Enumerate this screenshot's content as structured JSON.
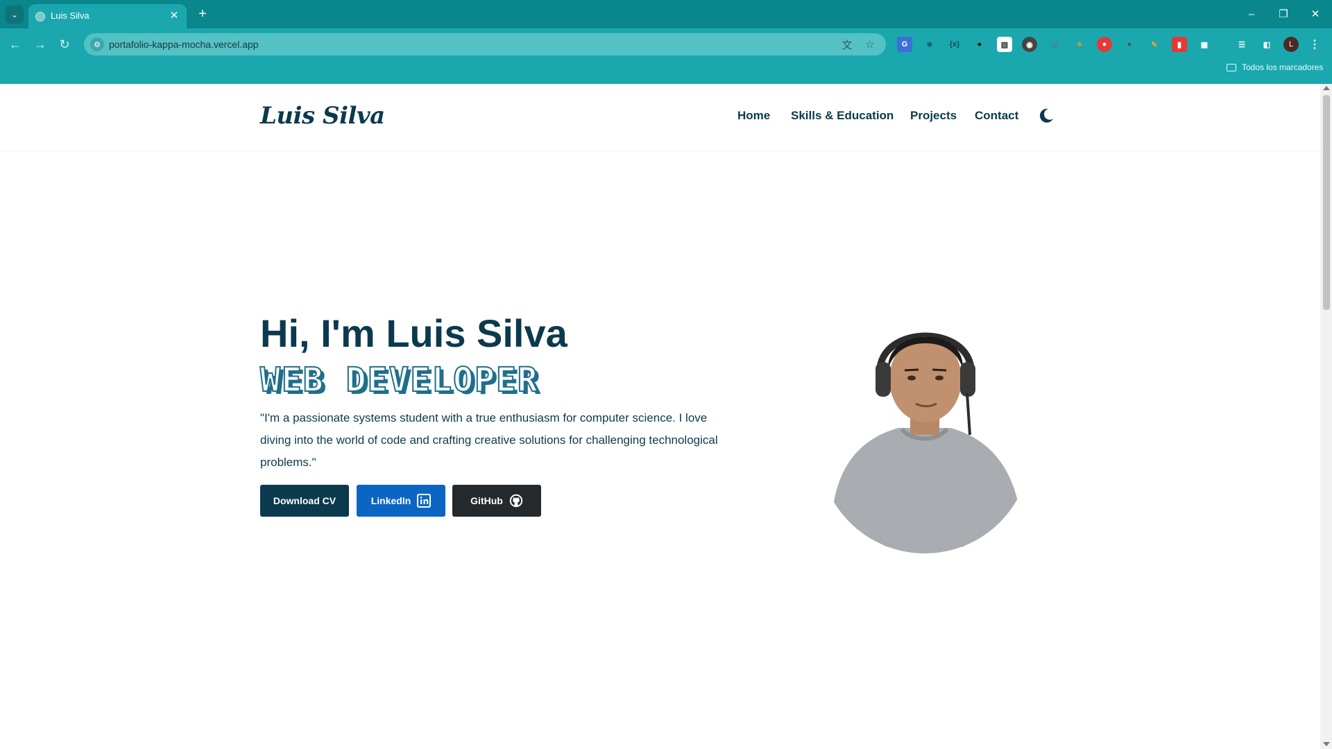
{
  "browser": {
    "tab_title": "Luis Silva",
    "url": "portafolio-kappa-mocha.vercel.app",
    "bookmarks_label": "Todos los marcadores",
    "profile_initial": "L"
  },
  "site": {
    "logo": "Luis Silva",
    "nav": [
      "Home",
      "Skills & Education",
      "Projects",
      "Contact"
    ]
  },
  "hero": {
    "title": "Hi, I'm Luis Silva",
    "subtitle": "WEB DEVELOPER",
    "description": "\"I'm a passionate systems student with a true enthusiasm for computer science. I love diving into the world of code and crafting creative solutions for challenging technological problems.\"",
    "buttons": {
      "cv": "Download CV",
      "linkedin": "LinkedIn",
      "github": "GitHub"
    }
  },
  "colors": {
    "tabstrip": "#0a878d",
    "toolbar": "#1aa8ae",
    "primary": "#0b3a4e",
    "linkedin": "#0a66c2",
    "github": "#24292e"
  }
}
